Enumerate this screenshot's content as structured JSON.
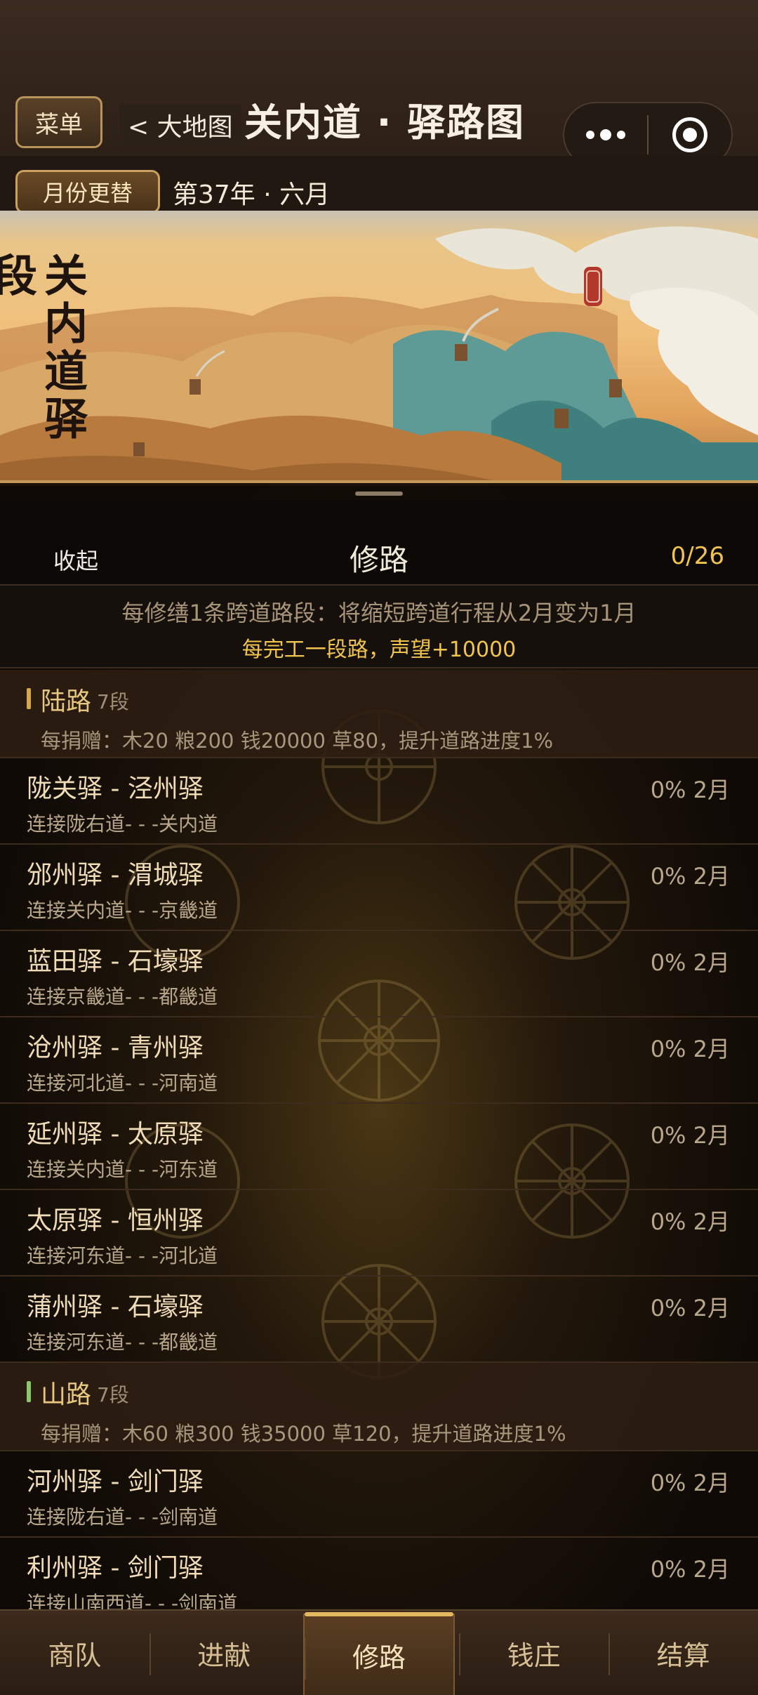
{
  "header": {
    "menu_label": "菜单",
    "back_label": "< 大地图",
    "title": "关内道 · 驿路图",
    "capsule": {
      "more_icon": "more-dots-icon",
      "close_icon": "target-circle-icon"
    }
  },
  "month_bar": {
    "button_label": "月份更替",
    "date": "第37年 · 六月"
  },
  "banner": {
    "vertical_title": "关内道驿段",
    "seal_icon": "red-seal-icon"
  },
  "panel": {
    "collapse_label": "收起",
    "title": "修路",
    "progress": "0/26",
    "notice_line1": "每修缮1条跨道路段：将缩短跨道行程从2月变为1月",
    "notice_line2": "每完工一段路，声望+10000"
  },
  "groups": [
    {
      "name": "陆路",
      "count": "7段",
      "cost": "每捐赠：木20 粮200 钱20000 草80，提升道路进度1%",
      "routes": [
        {
          "name": "陇关驿 - 泾州驿",
          "conn": "连接陇右道- - -关内道",
          "status": "0% 2月"
        },
        {
          "name": "邠州驿 - 渭城驿",
          "conn": "连接关内道- - -京畿道",
          "status": "0% 2月"
        },
        {
          "name": "蓝田驿 - 石壕驿",
          "conn": "连接京畿道- - -都畿道",
          "status": "0% 2月"
        },
        {
          "name": "沧州驿 - 青州驿",
          "conn": "连接河北道- - -河南道",
          "status": "0% 2月"
        },
        {
          "name": "延州驿 - 太原驿",
          "conn": "连接关内道- - -河东道",
          "status": "0% 2月"
        },
        {
          "name": "太原驿 - 恒州驿",
          "conn": "连接河东道- - -河北道",
          "status": "0% 2月"
        },
        {
          "name": "蒲州驿 - 石壕驿",
          "conn": "连接河东道- - -都畿道",
          "status": "0% 2月"
        }
      ]
    },
    {
      "name": "山路",
      "count": "7段",
      "cost": "每捐赠：木60 粮300 钱35000 草120，提升道路进度1%",
      "routes": [
        {
          "name": "河州驿 - 剑门驿",
          "conn": "连接陇右道- - -剑南道",
          "status": "0% 2月"
        },
        {
          "name": "利州驿 - 剑门驿",
          "conn": "连接山南西道- - -剑南道",
          "status": "0% 2月"
        }
      ]
    }
  ],
  "tabs": [
    {
      "label": "商队",
      "active": false
    },
    {
      "label": "进献",
      "active": false
    },
    {
      "label": "修路",
      "active": true
    },
    {
      "label": "钱庄",
      "active": false
    },
    {
      "label": "结算",
      "active": false
    }
  ],
  "colors": {
    "accent_gold": "#f1c44e",
    "land_marker": "#d4a94e",
    "mountain_marker": "#8fc56d"
  }
}
